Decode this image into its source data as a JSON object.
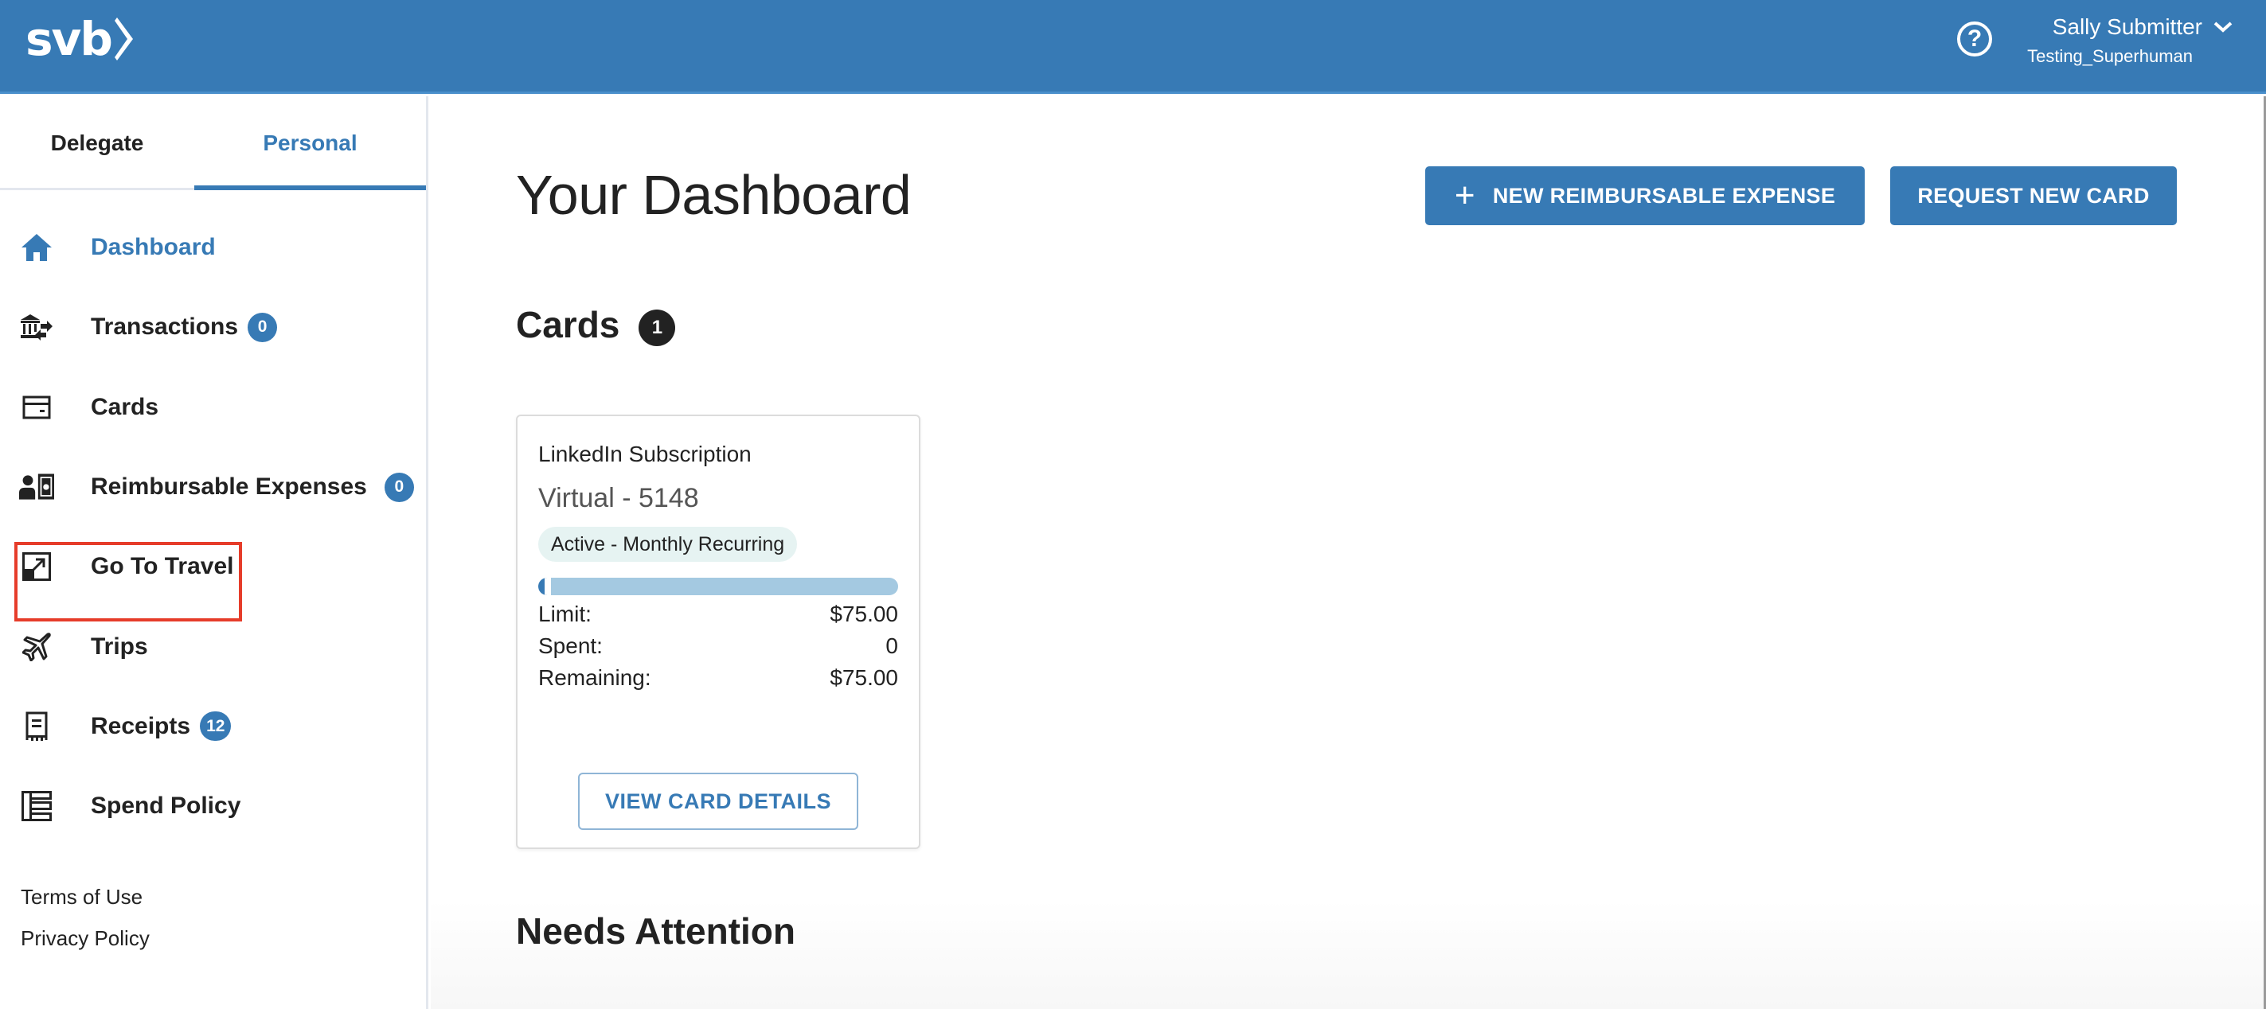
{
  "header": {
    "logo_text": "svb",
    "help_icon": "help-circle-icon",
    "user_name": "Sally Submitter",
    "user_org": "Testing_Superhuman",
    "brand_color": "#377ab5"
  },
  "sidebar": {
    "tabs": [
      {
        "label": "Delegate",
        "active": false
      },
      {
        "label": "Personal",
        "active": true
      }
    ],
    "items": [
      {
        "label": "Dashboard",
        "icon": "home-icon",
        "active": true,
        "badge": null
      },
      {
        "label": "Transactions",
        "icon": "bank-transfer-icon",
        "active": false,
        "badge": "0"
      },
      {
        "label": "Cards",
        "icon": "credit-card-icon",
        "active": false,
        "badge": null
      },
      {
        "label": "Reimbursable Expenses",
        "icon": "person-money-icon",
        "active": false,
        "badge": "0"
      },
      {
        "label": "Go To Travel",
        "icon": "external-link-icon",
        "active": false,
        "badge": null,
        "highlighted": true
      },
      {
        "label": "Trips",
        "icon": "airplane-icon",
        "active": false,
        "badge": null
      },
      {
        "label": "Receipts",
        "icon": "receipt-icon",
        "active": false,
        "badge": "12"
      },
      {
        "label": "Spend Policy",
        "icon": "policy-list-icon",
        "active": false,
        "badge": null
      }
    ],
    "footer_links": [
      "Terms of Use",
      "Privacy Policy"
    ]
  },
  "main": {
    "title": "Your Dashboard",
    "buttons": {
      "new_expense": "NEW REIMBURSABLE EXPENSE",
      "request_card": "REQUEST NEW CARD"
    },
    "cards_section": {
      "title": "Cards",
      "count": "1",
      "cards": [
        {
          "name": "LinkedIn Subscription",
          "number": "Virtual - 5148",
          "status": "Active - Monthly Recurring",
          "spent_fraction": 0,
          "limit_label": "Limit:",
          "limit": "$75.00",
          "spent_label": "Spent:",
          "spent": "0",
          "remaining_label": "Remaining:",
          "remaining": "$75.00",
          "details_button": "VIEW CARD DETAILS"
        }
      ]
    },
    "needs_attention_title": "Needs Attention"
  }
}
